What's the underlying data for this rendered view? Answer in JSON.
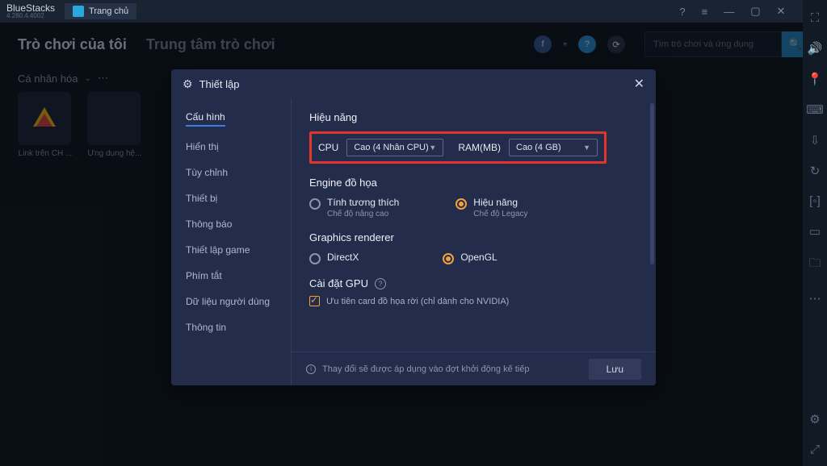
{
  "titlebar": {
    "name": "BlueStacks",
    "version": "4.280.4.4002",
    "home": "Trang chủ"
  },
  "nav": {
    "tab_mygames": "Trò chơi của tôi",
    "tab_gamecenter": "Trung tâm trò chơi",
    "search_placeholder": "Tìm trò chơi và ứng dụng"
  },
  "subhdr": {
    "personalize": "Cá nhân hóa"
  },
  "apps": {
    "app1": "Link trên CH ...",
    "app2": "Ứng dụng hệ..."
  },
  "modal": {
    "title": "Thiết lập",
    "nav": {
      "config": "Cấu hình",
      "display": "Hiển thị",
      "custom": "Tùy chỉnh",
      "device": "Thiết bị",
      "notify": "Thông báo",
      "gamesettings": "Thiết lập game",
      "shortcuts": "Phím tắt",
      "userdata": "Dữ liệu người dùng",
      "about": "Thông tin"
    },
    "perf": {
      "heading": "Hiệu năng",
      "cpu_label": "CPU",
      "cpu_value": "Cao (4 Nhân CPU)",
      "ram_label": "RAM(MB)",
      "ram_value": "Cao (4 GB)"
    },
    "engine": {
      "heading": "Engine đồ họa",
      "compat": "Tính tương thích",
      "compat_sub": "Chế độ nâng cao",
      "perf": "Hiệu năng",
      "perf_sub": "Chế độ Legacy"
    },
    "renderer": {
      "heading": "Graphics renderer",
      "dx": "DirectX",
      "gl": "OpenGL"
    },
    "gpu": {
      "heading": "Cài đặt GPU",
      "checkbox": "Ưu tiên card đồ họa rời (chỉ dành cho NVIDIA)"
    },
    "footer": {
      "note": "Thay đổi sẽ được áp dụng vào đợt khởi động kế tiếp",
      "save": "Lưu"
    }
  }
}
